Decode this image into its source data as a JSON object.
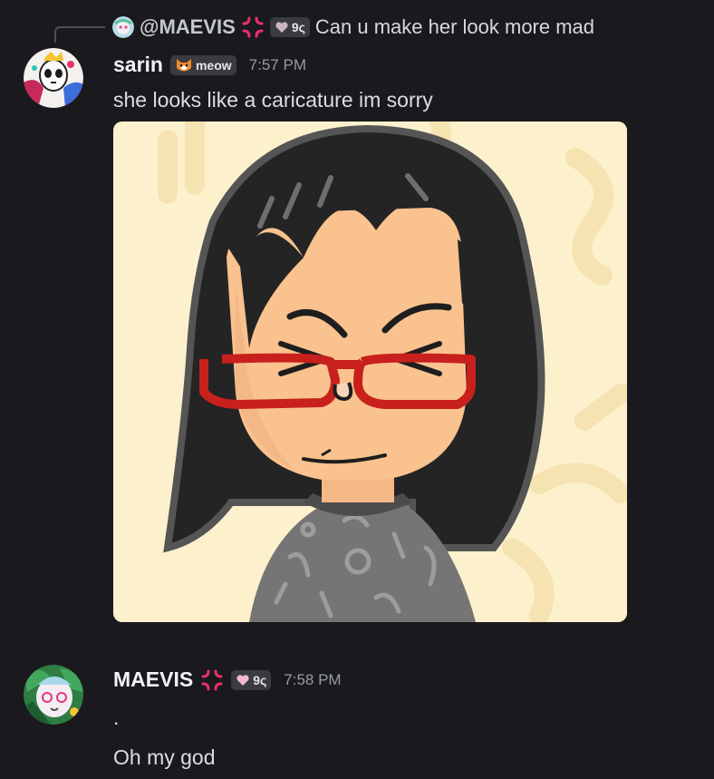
{
  "reply": {
    "mention": "@MAEVIS",
    "tag_text": "9ς",
    "text": "Can u make her look more mad"
  },
  "message1": {
    "username": "sarin",
    "tag_text": "meow",
    "timestamp": "7:57 PM",
    "text": "she looks like a caricature im sorry",
    "attachment_alt": "mii-image"
  },
  "message2": {
    "username": "MAEVIS",
    "tag_text": "9ς",
    "timestamp": "7:58 PM",
    "line1": ".",
    "line2": "Oh my god"
  },
  "colors": {
    "background": "#1a1a1e",
    "username": "#f2f3f5",
    "timestamp": "#949ba4",
    "text": "#dbdee1",
    "tag_bg": "#3a3b40",
    "anger_icon": "#e8306b"
  },
  "icons": [
    "reply-spine",
    "anger-icon",
    "heart-icon",
    "cat-icon",
    "avatar"
  ]
}
